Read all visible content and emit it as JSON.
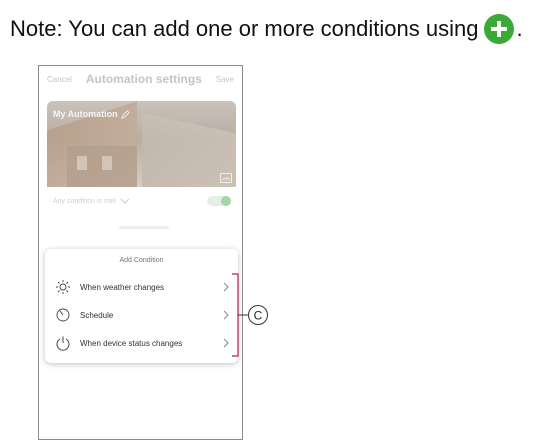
{
  "note": {
    "text": "Note: You can add one or more conditions using",
    "icon": "plus-circle-icon",
    "trailing": ".",
    "accent_color": "#3aa935"
  },
  "topbar": {
    "cancel_label": "Cancel",
    "title": "Automation settings",
    "save_label": "Save"
  },
  "banner": {
    "automation_name": "My Automation",
    "edit_icon": "pencil-icon",
    "image_icon": "image-icon"
  },
  "condition_row": {
    "label": "Any condition is met",
    "icon": "chevron-down-icon"
  },
  "sheet": {
    "title": "Add Condition",
    "items": [
      {
        "label": "When weather changes",
        "icon": "weather-sun-icon"
      },
      {
        "label": "Schedule",
        "icon": "timer-icon"
      },
      {
        "label": "When device status changes",
        "icon": "power-icon"
      }
    ]
  },
  "callout": {
    "label": "C"
  }
}
